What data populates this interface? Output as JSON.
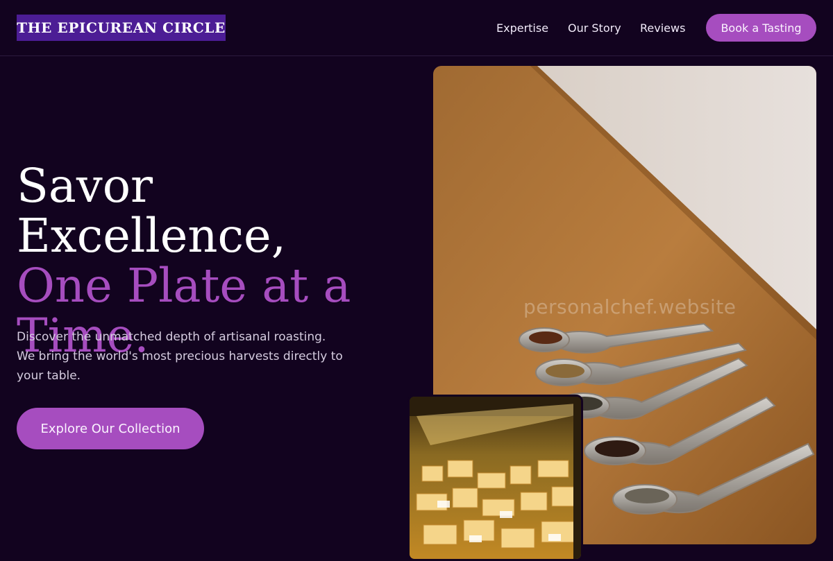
{
  "brand": {
    "name": "THE EPICUREAN CIRCLE"
  },
  "nav": {
    "links": [
      "Expertise",
      "Our Story",
      "Reviews"
    ],
    "cta_label": "Book a Tasting"
  },
  "hero": {
    "headline_line1": "Savor Excellence,",
    "headline_line2": "One Plate at a Time.",
    "description": "Discover the unmatched depth of artisanal roasting. We bring the world's most precious harvests directly to your table.",
    "cta_label": "Explore Our Collection"
  },
  "images": {
    "main_photo": "spoons-with-spices-on-wooden-table",
    "secondary_photo": "cheese-display-case",
    "watermark": "personalchef.website"
  },
  "colors": {
    "background": "#12031f",
    "accent": "#a64dbf",
    "logo_bg": "#4c1d95"
  }
}
